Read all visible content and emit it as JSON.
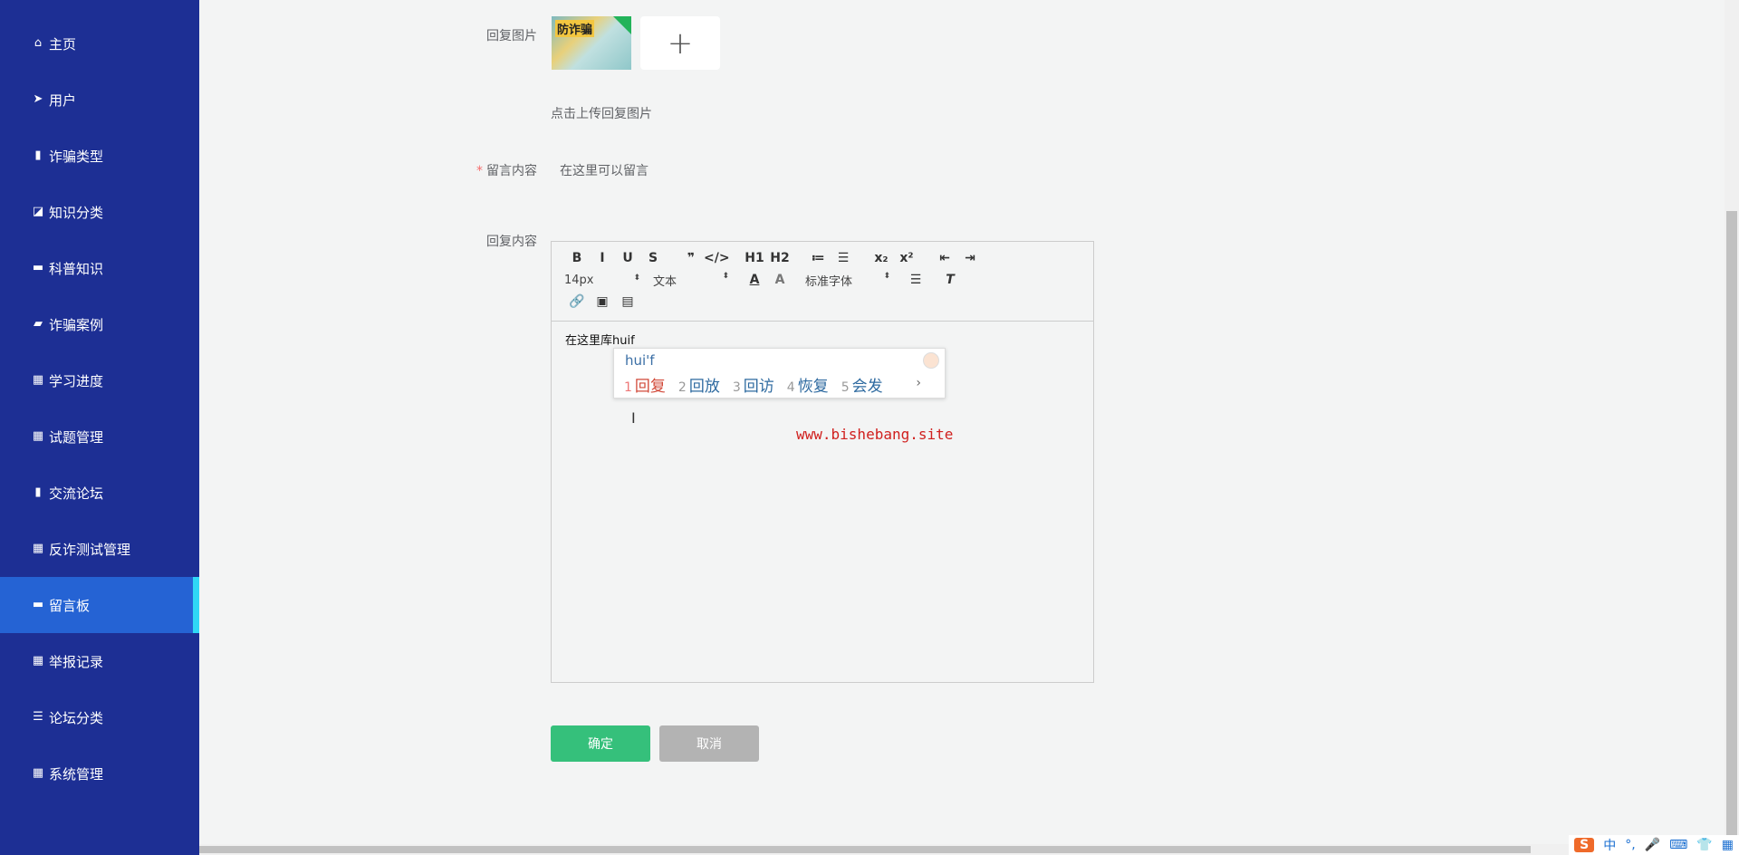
{
  "sidebar": {
    "items": [
      {
        "label": "主页",
        "icon": "home-icon",
        "glyph": "⌂"
      },
      {
        "label": "用户",
        "icon": "paper-plane-icon",
        "glyph": "➤"
      },
      {
        "label": "诈骗类型",
        "icon": "clipboard-icon",
        "glyph": "▮"
      },
      {
        "label": "知识分类",
        "icon": "chart-icon",
        "glyph": "◪"
      },
      {
        "label": "科普知识",
        "icon": "ticket-icon",
        "glyph": "▬"
      },
      {
        "label": "诈骗案例",
        "icon": "briefcase-icon",
        "glyph": "▰"
      },
      {
        "label": "学习进度",
        "icon": "grid-icon",
        "glyph": "▦"
      },
      {
        "label": "试题管理",
        "icon": "grid-icon",
        "glyph": "▦"
      },
      {
        "label": "交流论坛",
        "icon": "clipboard-check-icon",
        "glyph": "▮"
      },
      {
        "label": "反诈测试管理",
        "icon": "grid-icon",
        "glyph": "▦"
      },
      {
        "label": "留言板",
        "icon": "message-icon",
        "glyph": "▬"
      },
      {
        "label": "举报记录",
        "icon": "grid-icon",
        "glyph": "▦"
      },
      {
        "label": "论坛分类",
        "icon": "list-icon",
        "glyph": "☰"
      },
      {
        "label": "系统管理",
        "icon": "grid-icon",
        "glyph": "▦"
      }
    ],
    "active": "留言板"
  },
  "form": {
    "reply_image_label": "回复图片",
    "thumb_text": "防诈骗",
    "upload_plus": "+",
    "upload_hint": "点击上传回复图片",
    "required_mark": "*",
    "message_label": "留言内容",
    "message_value": "在这里可以留言",
    "reply_label": "回复内容"
  },
  "editor": {
    "buttons": [
      "B",
      "I",
      "U",
      "S",
      "❞",
      "</>",
      "H1",
      "H2",
      "≔",
      "☰",
      "x₂",
      "x²",
      "⇤",
      "⇥"
    ],
    "font_size": "14px",
    "block_type": "文本",
    "font_family": "标准字体",
    "content": "在这里库huif"
  },
  "ime": {
    "composition": "hui'f",
    "candidates": [
      {
        "n": "1",
        "w": "回复"
      },
      {
        "n": "2",
        "w": "回放"
      },
      {
        "n": "3",
        "w": "回访"
      },
      {
        "n": "4",
        "w": "恢复"
      },
      {
        "n": "5",
        "w": "会发"
      }
    ],
    "more": "›"
  },
  "watermark": "www.bishebang.site",
  "actions": {
    "confirm": "确定",
    "cancel": "取消",
    "confirm_color": "#35c07b",
    "cancel_color": "#b3b3b3"
  },
  "tray": {
    "logo": "S",
    "mode": "中",
    "punct": "°,",
    "items": [
      "🎤",
      "⌨",
      "👕",
      "▦"
    ]
  }
}
